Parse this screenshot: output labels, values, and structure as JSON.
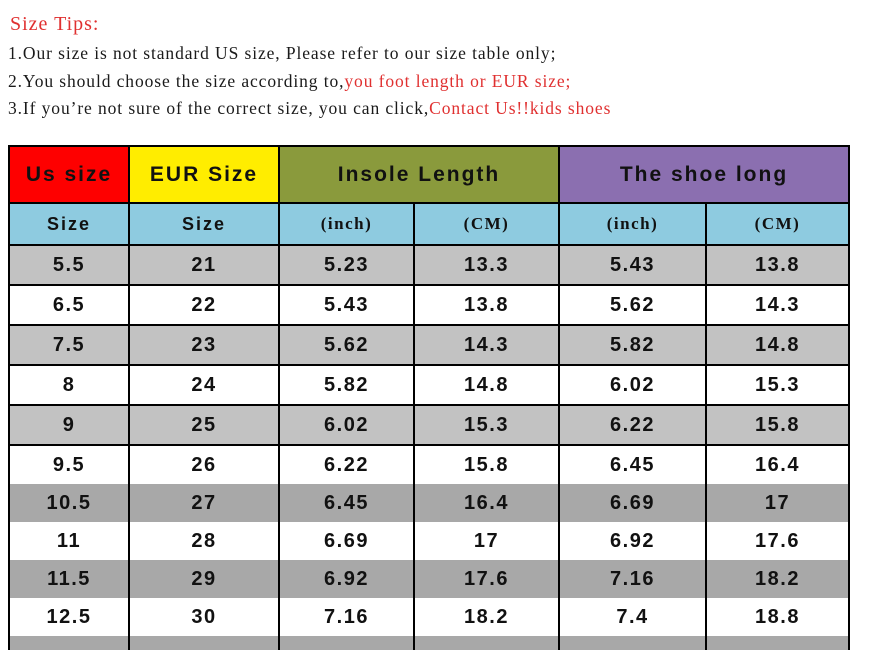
{
  "tips": {
    "heading": "Size Tips:",
    "lines": [
      {
        "black": "1.Our size is not standard US size, Please refer to our size table only;",
        "red": ""
      },
      {
        "black": "2.You should choose the size according to,",
        "red": "you foot length or EUR size;"
      },
      {
        "black": "3.If you’re not sure of the correct size, you can click,",
        "red": "Contact Us!!kids shoes"
      }
    ]
  },
  "table": {
    "bands": [
      {
        "label": "Us size",
        "color": "#fe0000"
      },
      {
        "label": "EUR Size",
        "color": "#ffed00"
      },
      {
        "label": "Insole Length",
        "color": "#8a9a3c"
      },
      {
        "label": "The shoe long",
        "color": "#8b6fb0"
      }
    ],
    "subheaders": [
      "Size",
      "Size",
      "(inch)",
      "(CM)",
      "(inch)",
      "(CM)"
    ],
    "rows": [
      [
        "5.5",
        "21",
        "5.23",
        "13.3",
        "5.43",
        "13.8"
      ],
      [
        "6.5",
        "22",
        "5.43",
        "13.8",
        "5.62",
        "14.3"
      ],
      [
        "7.5",
        "23",
        "5.62",
        "14.3",
        "5.82",
        "14.8"
      ],
      [
        "8",
        "24",
        "5.82",
        "14.8",
        "6.02",
        "15.3"
      ],
      [
        "9",
        "25",
        "6.02",
        "15.3",
        "6.22",
        "15.8"
      ],
      [
        "9.5",
        "26",
        "6.22",
        "15.8",
        "6.45",
        "16.4"
      ],
      [
        "10.5",
        "27",
        "6.45",
        "16.4",
        "6.69",
        "17"
      ],
      [
        "11",
        "28",
        "6.69",
        "17",
        "6.92",
        "17.6"
      ],
      [
        "11.5",
        "29",
        "6.92",
        "17.6",
        "7.16",
        "18.2"
      ],
      [
        "12.5",
        "30",
        "7.16",
        "18.2",
        "7.4",
        "18.8"
      ]
    ]
  },
  "colors": {
    "tip_red": "#e03030",
    "sub_header_blue": "#8ecbe0",
    "shade_light": "#c2c2c2",
    "shade_dark": "#a8a8a8",
    "border": "#000000"
  }
}
